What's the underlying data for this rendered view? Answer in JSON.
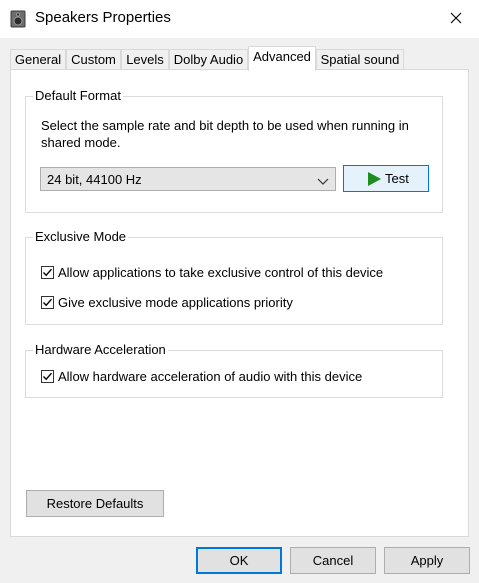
{
  "window": {
    "title": "Speakers Properties",
    "app_icon": "speaker-icon",
    "close_icon": "close-icon"
  },
  "tabs": [
    {
      "label": "General",
      "active": false
    },
    {
      "label": "Custom",
      "active": false
    },
    {
      "label": "Levels",
      "active": false
    },
    {
      "label": "Dolby Audio",
      "active": false
    },
    {
      "label": "Advanced",
      "active": true
    },
    {
      "label": "Spatial sound",
      "active": false
    }
  ],
  "default_format": {
    "group_label": "Default Format",
    "description": "Select the sample rate and bit depth to be used when running in shared mode.",
    "selected": "24 bit, 44100 Hz",
    "test_label": "Test",
    "test_icon": "play-icon"
  },
  "exclusive_mode": {
    "group_label": "Exclusive Mode",
    "options": [
      {
        "label": "Allow applications to take exclusive control of this device",
        "checked": true
      },
      {
        "label": "Give exclusive mode applications priority",
        "checked": true
      }
    ]
  },
  "hardware_acceleration": {
    "group_label": "Hardware Acceleration",
    "options": [
      {
        "label": "Allow hardware acceleration of audio with this device",
        "checked": true
      }
    ]
  },
  "buttons": {
    "restore_defaults": "Restore Defaults",
    "ok": "OK",
    "cancel": "Cancel",
    "apply": "Apply"
  },
  "colors": {
    "accent": "#0078d7",
    "play_green": "#1e8c1e"
  }
}
